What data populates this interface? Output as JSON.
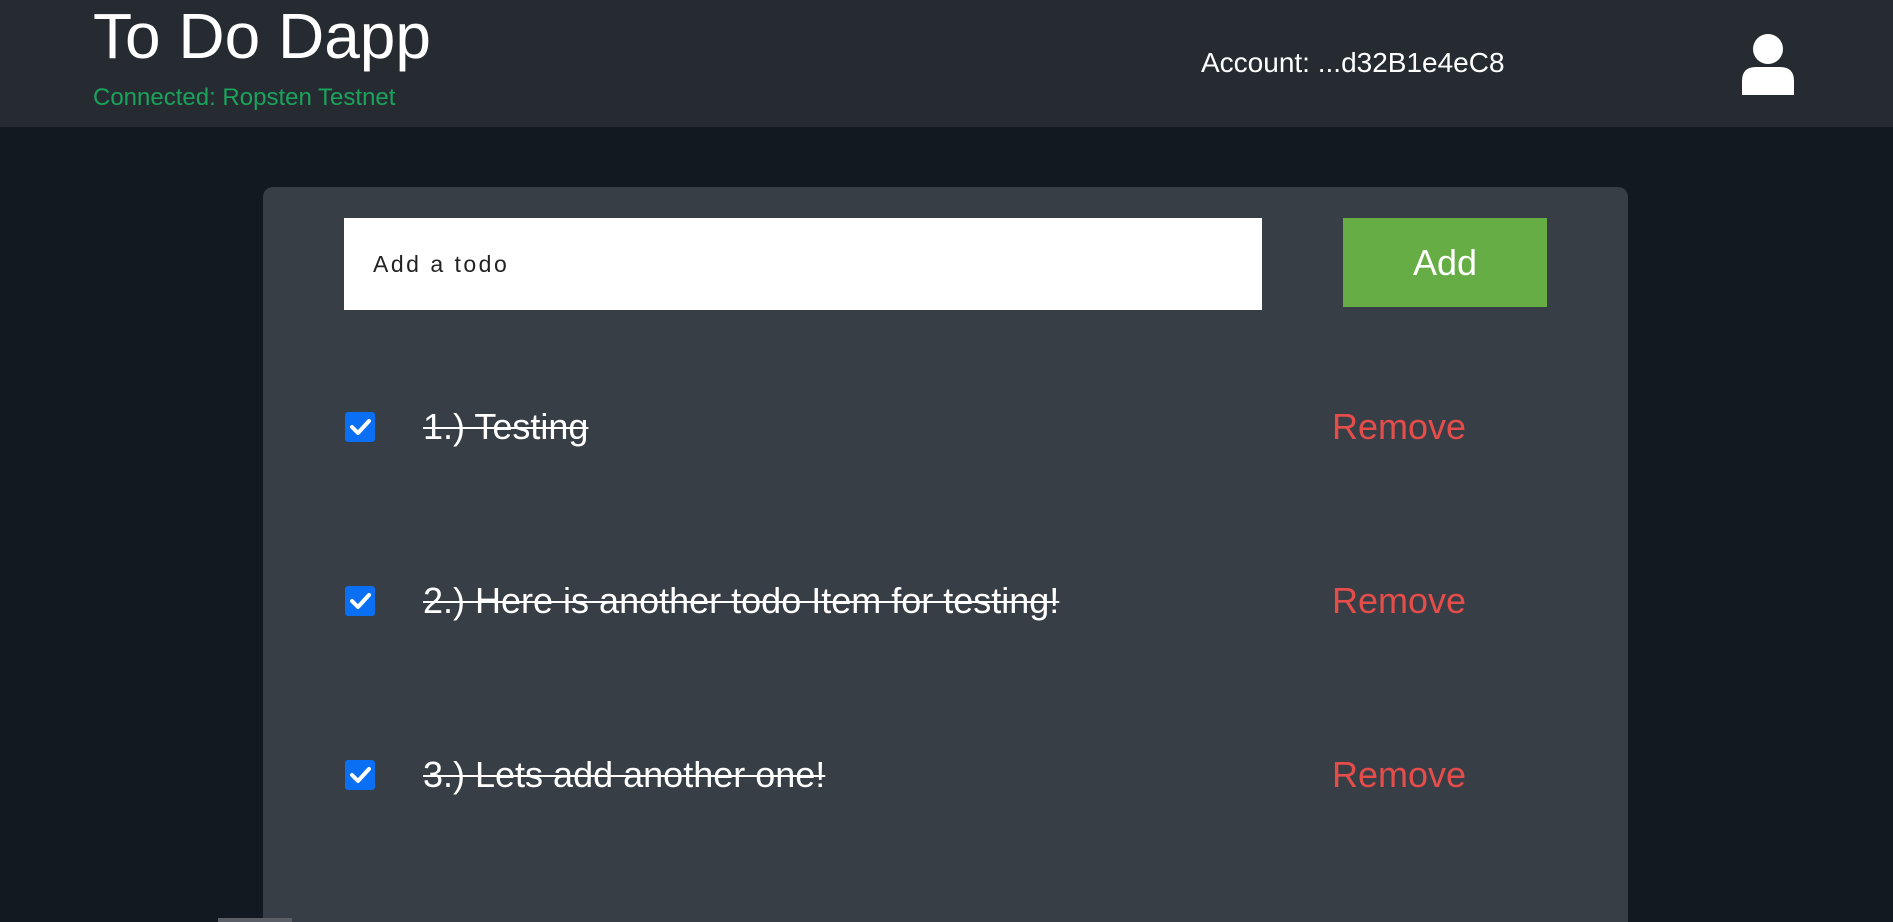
{
  "header": {
    "title": "To Do Dapp",
    "network_status": "Connected: Ropsten Testnet",
    "account": "Account: ...d32B1e4eC8",
    "avatar_icon": "user-icon"
  },
  "new_todo": {
    "placeholder": "Add a todo",
    "value": "",
    "add_label": "Add"
  },
  "todos": [
    {
      "text": "1.) Testing",
      "completed": true,
      "remove_label": "Remove"
    },
    {
      "text": "2.) Here is another todo Item for testing!",
      "completed": true,
      "remove_label": "Remove"
    },
    {
      "text": "3.) Lets add another one!",
      "completed": true,
      "remove_label": "Remove"
    }
  ],
  "colors": {
    "page_background": "#131920",
    "header_background": "#262b32",
    "panel_background": "#383e45",
    "status_green": "#1aa35a",
    "add_button_green": "#66ad46",
    "remove_red": "#e54d4b",
    "checkbox_blue": "#0a6ff2"
  }
}
